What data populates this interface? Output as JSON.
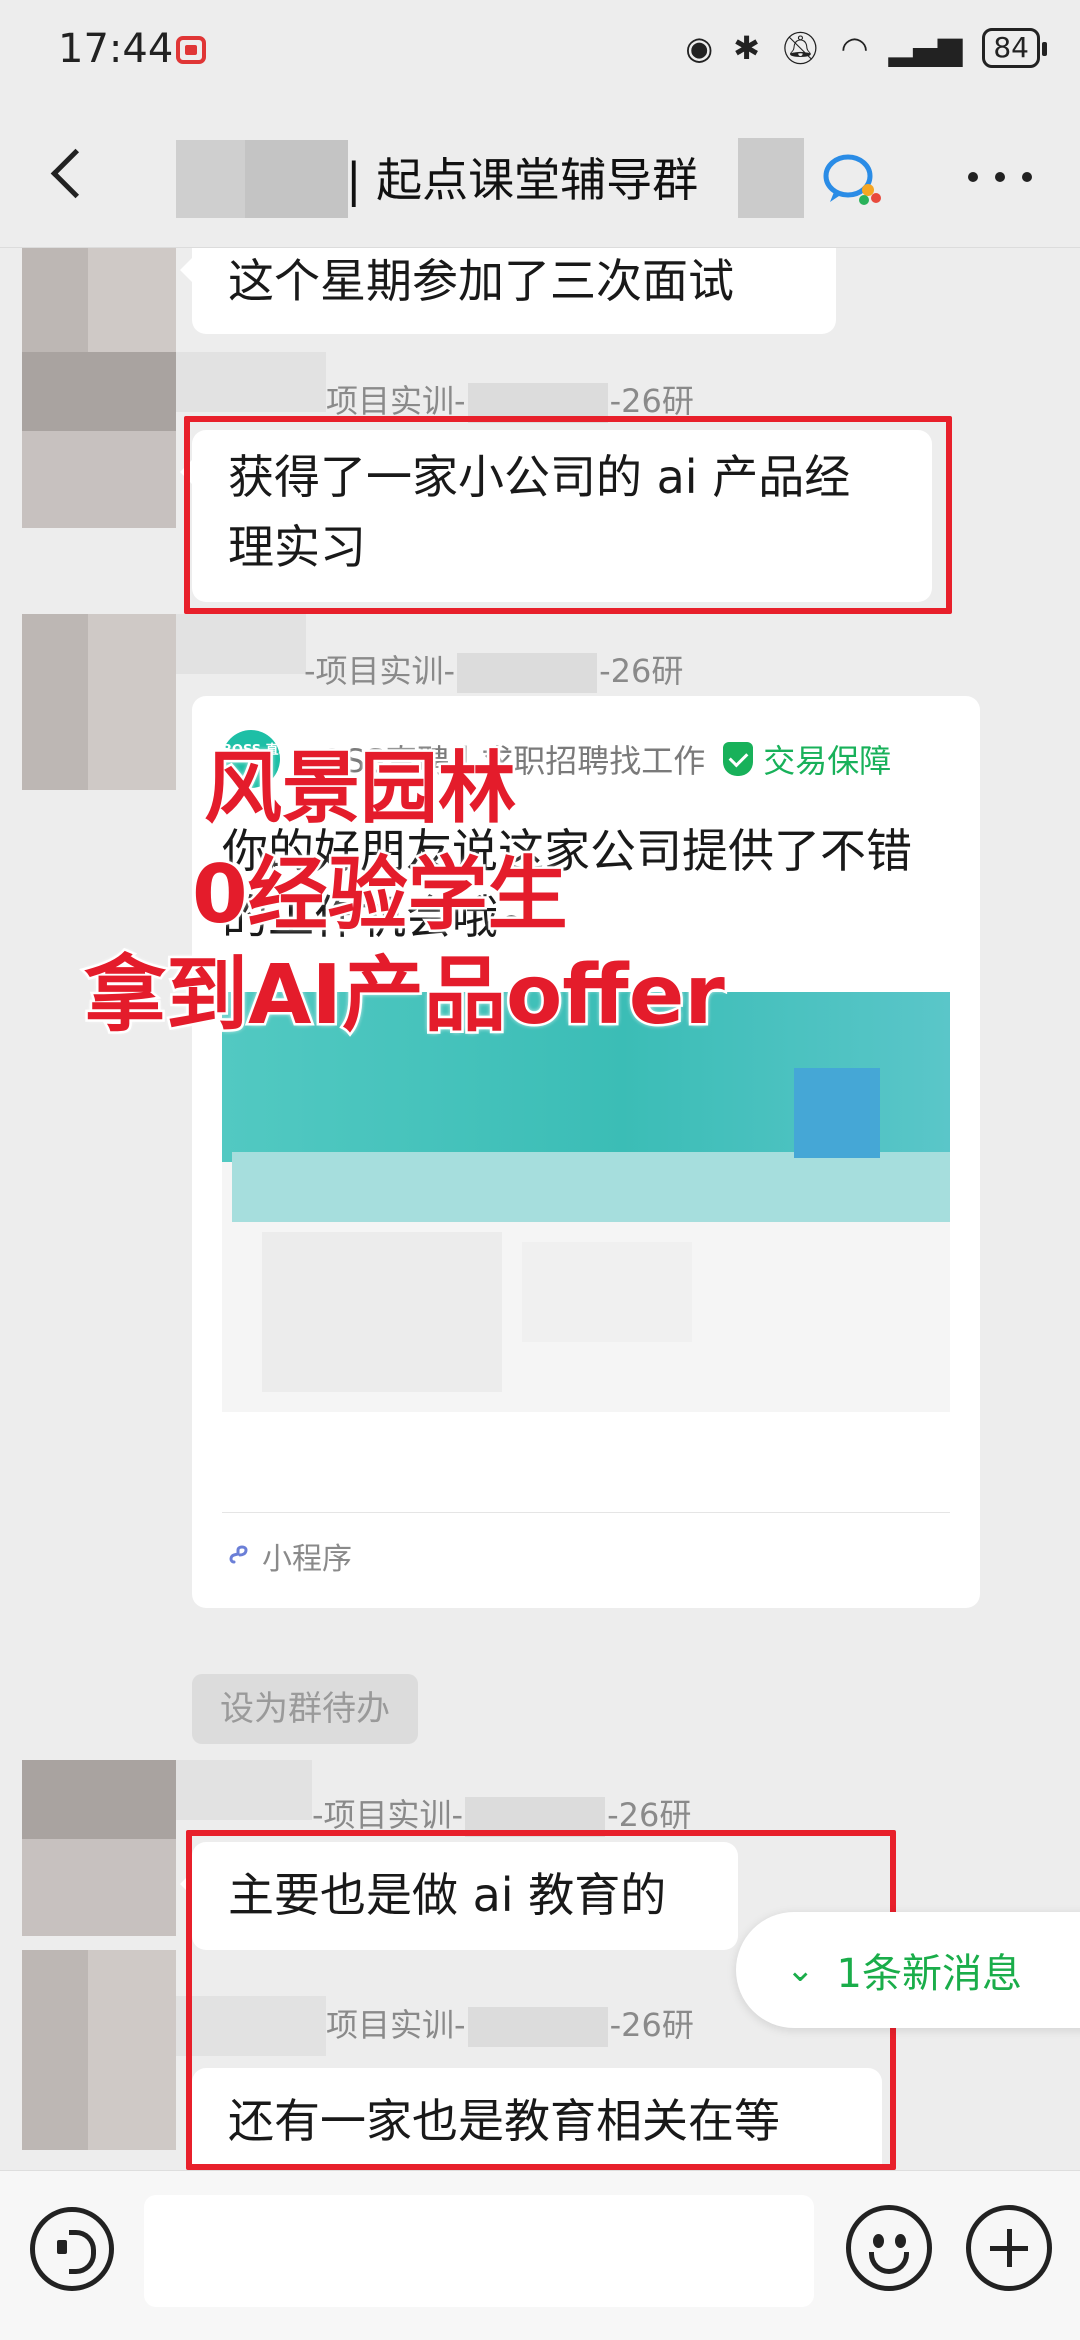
{
  "status_bar": {
    "time": "17:44",
    "battery": "84"
  },
  "header": {
    "title": "| 起点课堂辅导群"
  },
  "messages": [
    {
      "text": "这个星期参加了三次面试"
    },
    {
      "sender": "项目实训-",
      "sender_suffix": "-26研",
      "text": "获得了一家小公司的 ai 产品经理实习"
    },
    {
      "sender": "-项目实训-",
      "sender_suffix": "-26研"
    },
    {
      "sender": "-项目实训-",
      "sender_suffix": "-26研",
      "text": "主要也是做 ai 教育的"
    },
    {
      "sender": "项目实训-",
      "sender_suffix": "-26研",
      "text": "还有一家也是教育相关在等offer"
    }
  ],
  "mini_program": {
    "logo": "BOSS 直聘",
    "app_name": "BOSS直聘丨求职招聘找工作",
    "guarantee": "交易保障",
    "description": "你的好朋友说这家公司提供了不错的工作机会哦~",
    "footer": "小程序"
  },
  "overlay": {
    "line1": "风景园林",
    "line2": "0经验学生",
    "line3": "拿到AI产品offer"
  },
  "todo_button": "设为群待办",
  "new_message": "1条新消息",
  "colors": {
    "accent_green": "#1aad4a",
    "highlight_red": "#e8202b",
    "boss_teal": "#1dbfa6"
  }
}
